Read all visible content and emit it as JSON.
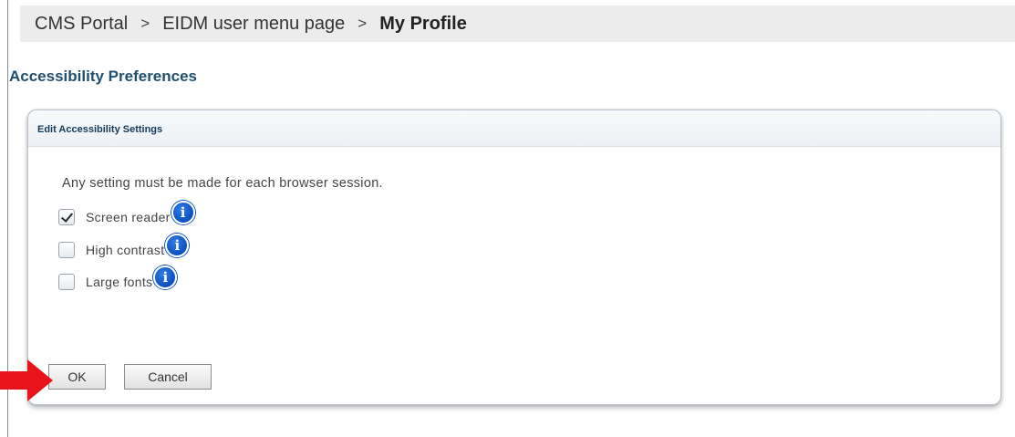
{
  "breadcrumb": {
    "items": [
      "CMS Portal",
      "EIDM user menu page"
    ],
    "separator": ">",
    "current": "My Profile"
  },
  "page_title": "Accessibility Preferences",
  "panel": {
    "title": "Edit Accessibility Settings",
    "note": "Any setting must be made for each browser session.",
    "options": [
      {
        "label": "Screen reader",
        "checked": true,
        "icon": "info-icon"
      },
      {
        "label": "High contrast",
        "checked": false,
        "icon": "info-icon"
      },
      {
        "label": "Large fonts",
        "checked": false,
        "icon": "info-icon"
      }
    ],
    "buttons": {
      "ok": "OK",
      "cancel": "Cancel"
    }
  },
  "colors": {
    "title": "#1f4f6e",
    "info_icon": "#0b4fbf",
    "arrow": "#e8131b",
    "breadcrumb_bg": "#ececec"
  },
  "icons": {
    "info": "i",
    "arrow": "right-arrow-icon"
  }
}
